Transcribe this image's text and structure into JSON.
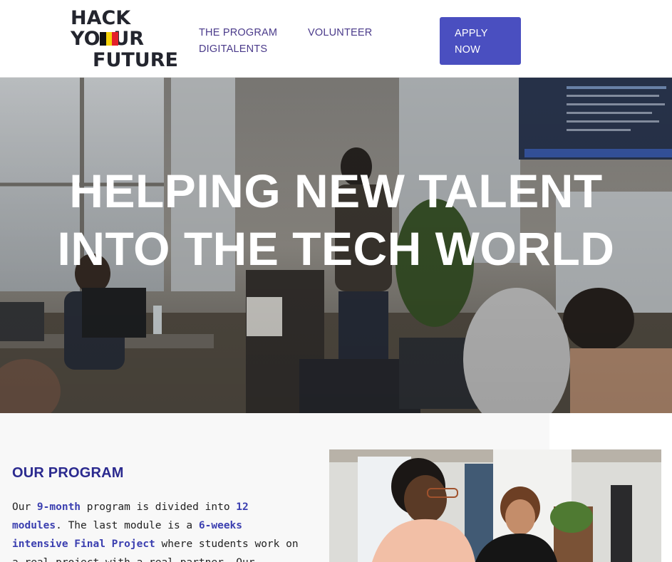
{
  "header": {
    "logo": {
      "line1": "HACK",
      "line2": "YO  UR",
      "line3": "FUTURE",
      "flag_colors": [
        "#111111",
        "#f5d20a",
        "#e3202a"
      ]
    },
    "nav": {
      "program": "THE PROGRAM",
      "volunteer": "VOLUNTEER",
      "digitalents": "DIGITALENTS"
    },
    "apply": {
      "line1": "APPLY",
      "line2": "NOW"
    }
  },
  "hero": {
    "title_line1": "HELPING NEW TALENT",
    "title_line2": "INTO THE TECH WORLD"
  },
  "program": {
    "heading": "OUR PROGRAM",
    "text": {
      "p1": "Our ",
      "b1": "9-month",
      "p2": " program is divided into ",
      "b2": "12 modules",
      "p3": ". The last module is a ",
      "b3": "6-weeks intensive Final Project",
      "p4": " where students work on a real project with a real partner. Our"
    }
  },
  "colors": {
    "nav_text": "#4a3a8a",
    "apply_bg": "#4a4fc0",
    "heading": "#2b2a8f",
    "highlight": "#3b3fb0"
  }
}
